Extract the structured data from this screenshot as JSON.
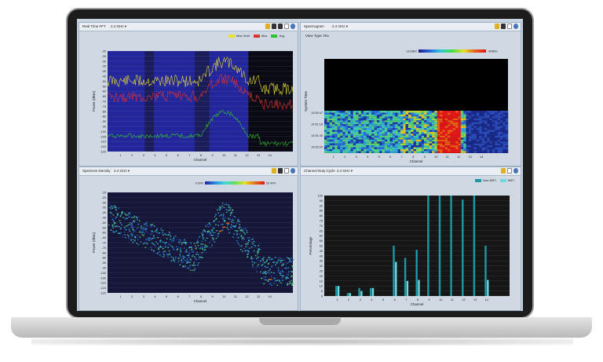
{
  "panels": {
    "rtfft": {
      "title": "Real Time FFT",
      "band": "2.4 GHz",
      "xlabel": "Channel",
      "ylabel": "Power (dBm)",
      "legend": [
        {
          "label": "Max Hold",
          "color": "#e8e030"
        },
        {
          "label": "Max",
          "color": "#e03030"
        },
        {
          "label": "Avg",
          "color": "#30c030"
        }
      ]
    },
    "spectrogram": {
      "title": "Spectrogram",
      "band": "2.4 GHz",
      "view_type": "View Type: Rtx",
      "xlabel": "Channel",
      "ylabel": "System Time",
      "scale_min": "-110dBm",
      "scale_max": "-40dBm",
      "times": [
        "14:50:47",
        "14:51:18",
        "14:51:49",
        "14:52:20"
      ]
    },
    "density": {
      "title": "Spectrum Density",
      "band": "2.4 GHz",
      "xlabel": "Channel",
      "ylabel": "Power (dBm)",
      "scale_min": "0.00%",
      "scale_max": "20.40%"
    },
    "dutycycle": {
      "title": "Channel Duty Cycle",
      "band": "2.4 GHz",
      "xlabel": "Channel",
      "ylabel": "Percentage",
      "legend": [
        {
          "label": "Non-WiFi",
          "color": "#1a9aa8"
        },
        {
          "label": "WiFi",
          "color": "#72d8e0"
        }
      ]
    }
  },
  "channels": [
    "1",
    "2",
    "3",
    "4",
    "5",
    "6",
    "7",
    "8",
    "9",
    "10",
    "11",
    "12",
    "13",
    "14"
  ],
  "dbm_ticks": [
    "-20",
    "-25",
    "-30",
    "-35",
    "-40",
    "-45",
    "-50",
    "-55",
    "-60",
    "-65",
    "-70",
    "-75",
    "-80",
    "-85",
    "-90",
    "-95",
    "-100",
    "-105",
    "-110",
    "-115",
    "-120"
  ],
  "pct_ticks": [
    "100",
    "95",
    "90",
    "85",
    "80",
    "75",
    "70",
    "65",
    "60",
    "55",
    "50",
    "45",
    "40",
    "35",
    "30",
    "25",
    "20",
    "15",
    "10",
    "5",
    "0"
  ],
  "chart_data": {
    "type": "bar",
    "title": "Channel Duty Cycle",
    "categories": [
      "1",
      "2",
      "3",
      "4",
      "5",
      "6",
      "7",
      "8",
      "9",
      "10",
      "11",
      "12",
      "13",
      "14"
    ],
    "series": [
      {
        "name": "Non-WiFi",
        "values": [
          10,
          3,
          8,
          8,
          0,
          50,
          38,
          46,
          100,
          100,
          100,
          96,
          100,
          50
        ]
      },
      {
        "name": "WiFi",
        "values": [
          10,
          3,
          5,
          8,
          0,
          34,
          15,
          16,
          0,
          0,
          0,
          0,
          0,
          16
        ]
      }
    ],
    "xlabel": "Channel",
    "ylabel": "Percentage",
    "ylim": [
      0,
      100
    ]
  }
}
